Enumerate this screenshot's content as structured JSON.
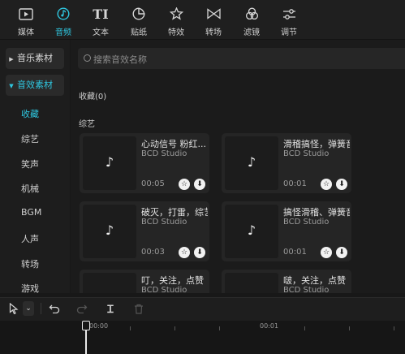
{
  "top_tabs": [
    {
      "label": "媒体",
      "icon": "media-icon"
    },
    {
      "label": "音频",
      "icon": "audio-icon",
      "active": true
    },
    {
      "label": "文本",
      "icon": "text-icon"
    },
    {
      "label": "贴纸",
      "icon": "sticker-icon"
    },
    {
      "label": "特效",
      "icon": "effects-icon"
    },
    {
      "label": "转场",
      "icon": "transition-icon"
    },
    {
      "label": "滤镜",
      "icon": "filter-icon"
    },
    {
      "label": "调节",
      "icon": "adjust-icon"
    }
  ],
  "sidebar": {
    "categories": [
      {
        "label": "音乐素材",
        "expanded": false
      },
      {
        "label": "音效素材",
        "expanded": true
      }
    ],
    "subitems": [
      "收藏",
      "综艺",
      "笑声",
      "机械",
      "BGM",
      "人声",
      "转场",
      "游戏"
    ],
    "active_sub": "收藏"
  },
  "search": {
    "placeholder": "搜索音效名称"
  },
  "sections": {
    "favorites": "收藏(0)",
    "variety": "综艺"
  },
  "cards": [
    {
      "title": "心动信号 粉红...",
      "artist": "BCD Studio",
      "duration": "00:05"
    },
    {
      "title": "滑稽搞怪，弹簧音",
      "artist": "BCD Studio",
      "duration": "00:01"
    },
    {
      "title": "破灭，打雷，综艺",
      "artist": "BCD Studio",
      "duration": "00:03"
    },
    {
      "title": "搞怪滑稽、弹簧音",
      "artist": "BCD Studio",
      "duration": "00:01"
    },
    {
      "title": "叮，关注，点赞",
      "artist": "BCD Studio",
      "duration": ""
    },
    {
      "title": "啵，关注，点赞",
      "artist": "BCD Studio",
      "duration": ""
    }
  ],
  "timeline": {
    "time_start": "00:00",
    "time_next": "00:01"
  }
}
